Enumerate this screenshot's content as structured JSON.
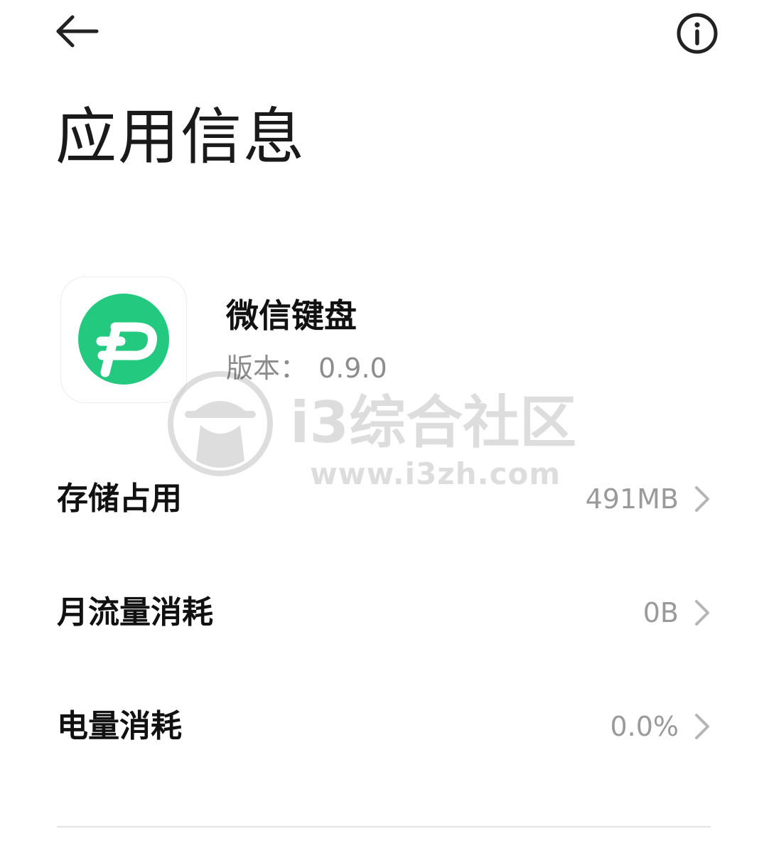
{
  "header": {
    "back_icon": "arrow-left-icon",
    "info_icon": "info-circle-icon"
  },
  "page": {
    "title": "应用信息"
  },
  "app": {
    "name": "微信键盘",
    "version_label": "版本：",
    "version": "0.9.0",
    "icon": "wechat-keyboard-logo",
    "icon_color": "#22c97f"
  },
  "watermark": {
    "text": "i3综合社区",
    "url": "www.i3zh.com"
  },
  "rows": [
    {
      "label": "存储占用",
      "value": "491MB"
    },
    {
      "label": "月流量消耗",
      "value": "0B"
    },
    {
      "label": "电量消耗",
      "value": "0.0%"
    }
  ],
  "colors": {
    "background": "#ffffff",
    "primary_text": "#111111",
    "secondary_text": "#9a9a9a",
    "chevron": "#b5b5b5",
    "divider": "#e4e4e4"
  }
}
